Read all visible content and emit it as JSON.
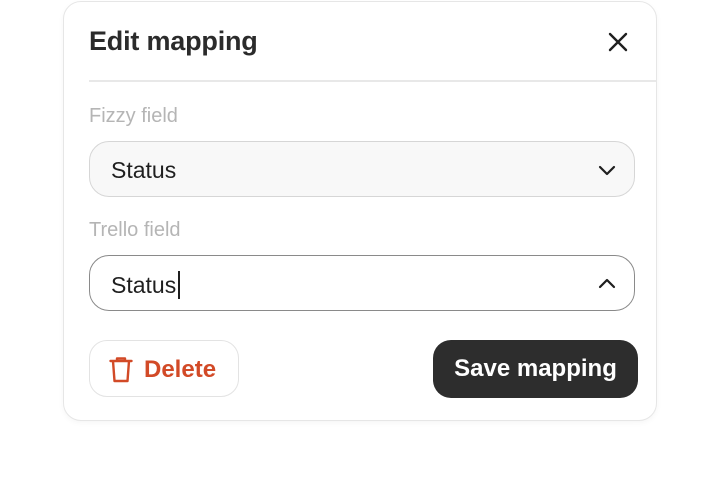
{
  "dialog": {
    "title": "Edit mapping",
    "close_icon": "close-icon"
  },
  "fizzy_field": {
    "label": "Fizzy field",
    "value": "Status",
    "icon": "chevron-down-icon"
  },
  "trello_field": {
    "label": "Trello field",
    "value": "Status",
    "icon": "chevron-up-icon"
  },
  "actions": {
    "delete_label": "Delete",
    "delete_icon": "trash-icon",
    "save_label": "Save mapping"
  },
  "colors": {
    "danger": "#d24a27",
    "primary_button": "#2d2d2d"
  }
}
